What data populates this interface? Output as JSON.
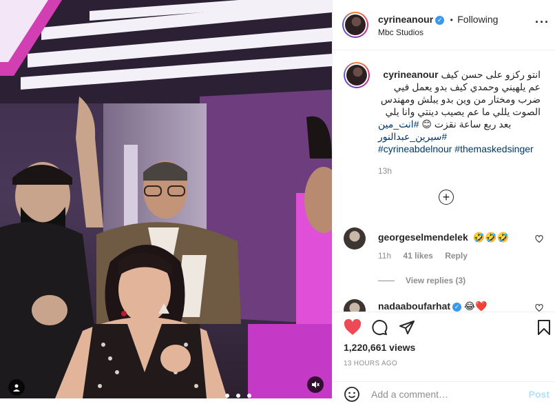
{
  "post": {
    "username": "cyrineanour",
    "following_label": "Following",
    "separator": "•",
    "location": "Mbc Studios"
  },
  "caption": {
    "username": "cyrineanour",
    "line1": "انتو ركزو على حسن كيف",
    "line2": "عم يلهيني وحمدي كيف بدو يعمل فيي",
    "line3": "ضرب ومختار من وين بدو يبلش ومهندس",
    "line4": "الصوت يللي ما عم يصيب دينتي وانا يلي",
    "line5": "بعد ربع ساعة نقزت 😊",
    "hashtag_ar1": "#انت_مين",
    "hashtag_ar2": "#سيرين_عبدالنور",
    "hashtags_en": "#cyrineabdelnour #themaskedsinger",
    "time": "13h"
  },
  "comments": [
    {
      "username": "georgeselmendelek",
      "text": "🤣🤣🤣",
      "time": "11h",
      "likes": "41 likes",
      "reply": "Reply",
      "view_replies": "View replies (3)"
    },
    {
      "username": "nadaaboufarhat",
      "text": "😂❤️"
    }
  ],
  "stats": {
    "views": "1,220,661 views",
    "posted_ago": "13 HOURS AGO"
  },
  "composer": {
    "placeholder": "Add a comment…",
    "post_label": "Post"
  },
  "colors": {
    "like_red": "#ed4956",
    "link_blue": "#00376b",
    "verified_blue": "#3897f0",
    "post_disabled": "#b2dffc"
  },
  "icons": [
    "heart-icon",
    "comment-icon",
    "share-icon",
    "bookmark-icon",
    "more-icon",
    "emoji-icon",
    "add-icon",
    "mute-icon"
  ]
}
